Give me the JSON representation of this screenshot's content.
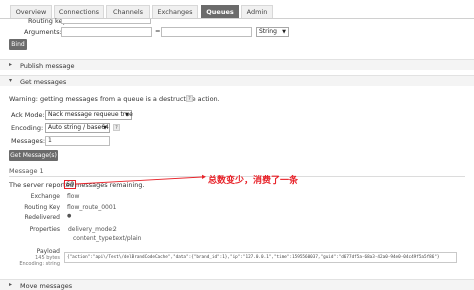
{
  "tabs": [
    {
      "label": "Overview"
    },
    {
      "label": "Connections"
    },
    {
      "label": "Channels"
    },
    {
      "label": "Exchanges"
    },
    {
      "label": "Queues"
    },
    {
      "label": "Admin"
    }
  ],
  "bind_form": {
    "routing_key_label": "Routing key:",
    "arguments_label": "Arguments:",
    "equals": "=",
    "type_select": "String",
    "bind_button": "Bind"
  },
  "sections": {
    "publish": "Publish message",
    "get": "Get messages",
    "move": "Move messages"
  },
  "get_messages": {
    "warning": "Warning: getting messages from a queue is a destructive action.",
    "help": "?",
    "ack_mode_label": "Ack Mode:",
    "ack_mode_value": "Nack message requeue true",
    "encoding_label": "Encoding:",
    "encoding_value": "Auto string / base64",
    "messages_label": "Messages:",
    "messages_value": "1",
    "button": "Get Message(s)"
  },
  "message": {
    "heading": "Message 1",
    "server_prefix": "The server reported",
    "remaining_count": "60",
    "server_suffix": "messages remaining.",
    "exchange_label": "Exchange",
    "exchange_value": "flow",
    "routing_key_label": "Routing Key",
    "routing_key_value": "flow_route_0001",
    "redelivered_label": "Redelivered",
    "redelivered_value": "●",
    "properties_label": "Properties",
    "delivery_mode_key": "delivery_mode:",
    "delivery_mode_value": "2",
    "content_type_key": "content_type:",
    "content_type_value": "text/plain",
    "payload_label": "Payload",
    "payload_bytes": "145 bytes",
    "payload_encoding": "Encoding: string",
    "payload_text": "{\"action\":\"api\\/Test\\/delBrandCodeCache\",\"data\":{\"brand_id\":1},\"ip\":\"127.0.0.1\",\"time\":1595560037,\"guid\":\"d677df5a-68a3-42a0-94e0-04c49f5a5f86\"}"
  },
  "annotation": {
    "text": "总数变少，消费了一条",
    "color": "#e8232a"
  }
}
